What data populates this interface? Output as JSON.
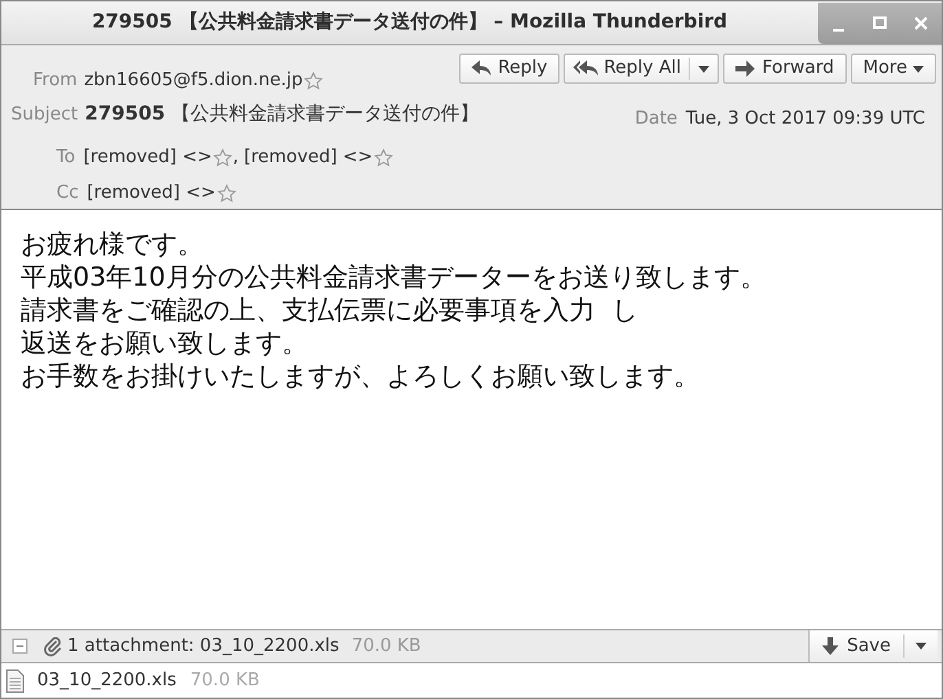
{
  "window": {
    "title": "279505 【公共料金請求書データ送付の件】 – Mozilla Thunderbird"
  },
  "actions": [
    {
      "label": "Reply",
      "kind": "reply"
    },
    {
      "label": "Reply All",
      "kind": "replyall"
    },
    {
      "label": "Forward",
      "kind": "forward"
    },
    {
      "label": "More",
      "kind": "more"
    }
  ],
  "header": {
    "from_label": "From",
    "from": "zbn16605@f5.dion.ne.jp",
    "subject_label": "Subject",
    "subject_id": "279505",
    "subject": "【公共料金請求書データ送付の件】",
    "date_label": "Date",
    "date": "Tue, 3 Oct 2017 09:39 UTC",
    "to_label": "To",
    "to_separator": ",",
    "to": [
      "[removed] <>",
      "[removed] <>"
    ],
    "cc_label": "Cc",
    "cc": [
      "[removed] <>"
    ]
  },
  "body": [
    "お疲れ様です。",
    "平成03年10月分の公共料金請求書データーをお送り致します。",
    "請求書をご確認の上、支払伝票に必要事項を入力  し",
    "返送をお願い致します。",
    "お手数をお掛けいたしますが、よろしくお願い致します。"
  ],
  "attachments_bar": {
    "expanded": true,
    "summary": "1 attachment: 03_10_2200.xls",
    "size": "70.0 KB",
    "save": "Save"
  },
  "attachments": [
    {
      "name": "03_10_2200.xls",
      "size": "70.0 KB"
    }
  ]
}
